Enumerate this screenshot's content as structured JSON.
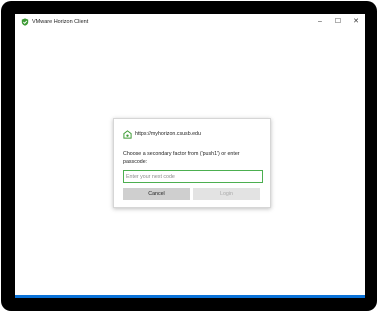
{
  "window": {
    "title": "VMware Horizon Client",
    "controls": {
      "minimize": "–",
      "maximize": "☐",
      "close": "✕"
    }
  },
  "dialog": {
    "server_url": "https://myhorizon.csusb.edu",
    "prompt": "Choose a secondary factor from ('push1') or enter passcode:",
    "passcode": {
      "value": "",
      "placeholder": "Enter your next code"
    },
    "buttons": {
      "cancel": "Cancel",
      "login": "Login"
    }
  },
  "colors": {
    "accent_green": "#4caf50",
    "taskbar_blue": "#0a72d8",
    "frame_black": "#000000"
  },
  "icons": {
    "app": "horizon-shield-icon",
    "server": "horizon-server-icon"
  }
}
